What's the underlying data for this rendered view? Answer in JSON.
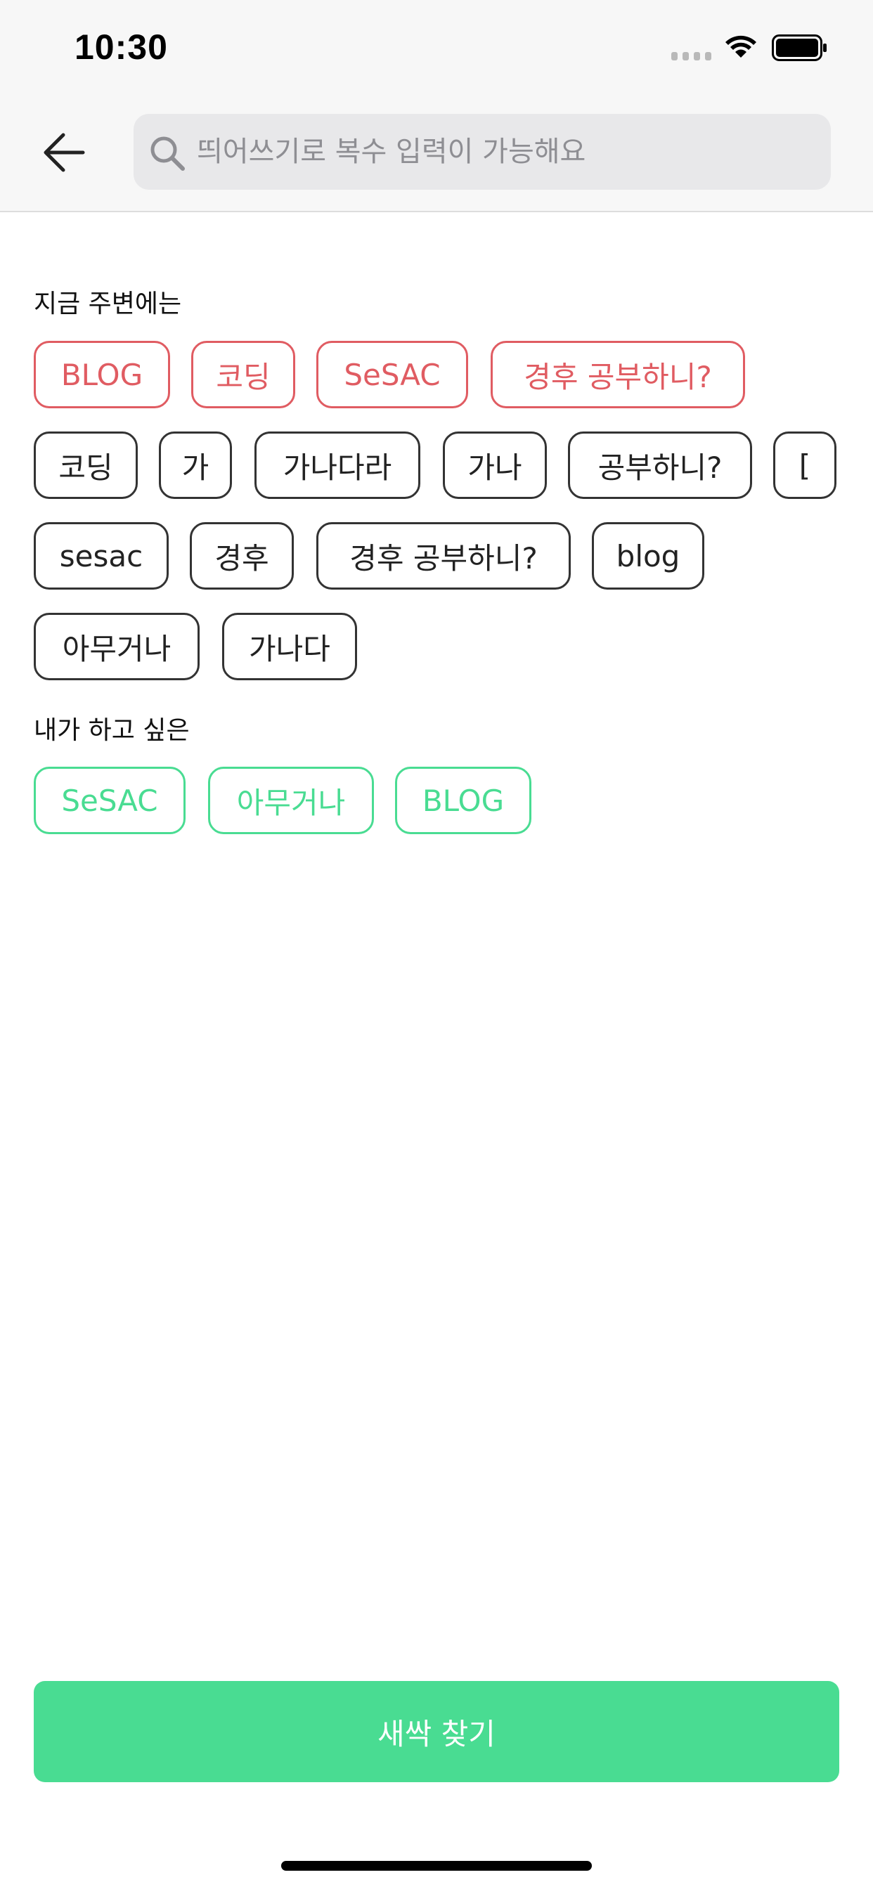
{
  "status_bar": {
    "time": "10:30"
  },
  "header": {
    "back_icon": "arrow-left-icon",
    "search": {
      "icon": "search-icon",
      "placeholder": "띄어쓰기로 복수 입력이 가능해요",
      "value": ""
    }
  },
  "nearby": {
    "title": "지금 주변에는",
    "recommended": [
      "BLOG",
      "코딩",
      "SeSAC",
      "경후 공부하니?"
    ],
    "tags": [
      "코딩",
      "가",
      "가나다라",
      "가나",
      "공부하니?",
      "[",
      "sesac",
      "경후",
      "경후 공부하니?",
      "blog",
      "아무거나",
      "가나다"
    ]
  },
  "my_tags": {
    "title": "내가 하고 싶은",
    "tags": [
      "SeSAC",
      "아무거나",
      "BLOG"
    ]
  },
  "find_button": {
    "label": "새싹 찾기"
  },
  "colors": {
    "accent_green": "#49dc92",
    "recommended_red": "#e05c62",
    "chip_border": "#333333",
    "placeholder_gray": "#8e8e93"
  }
}
